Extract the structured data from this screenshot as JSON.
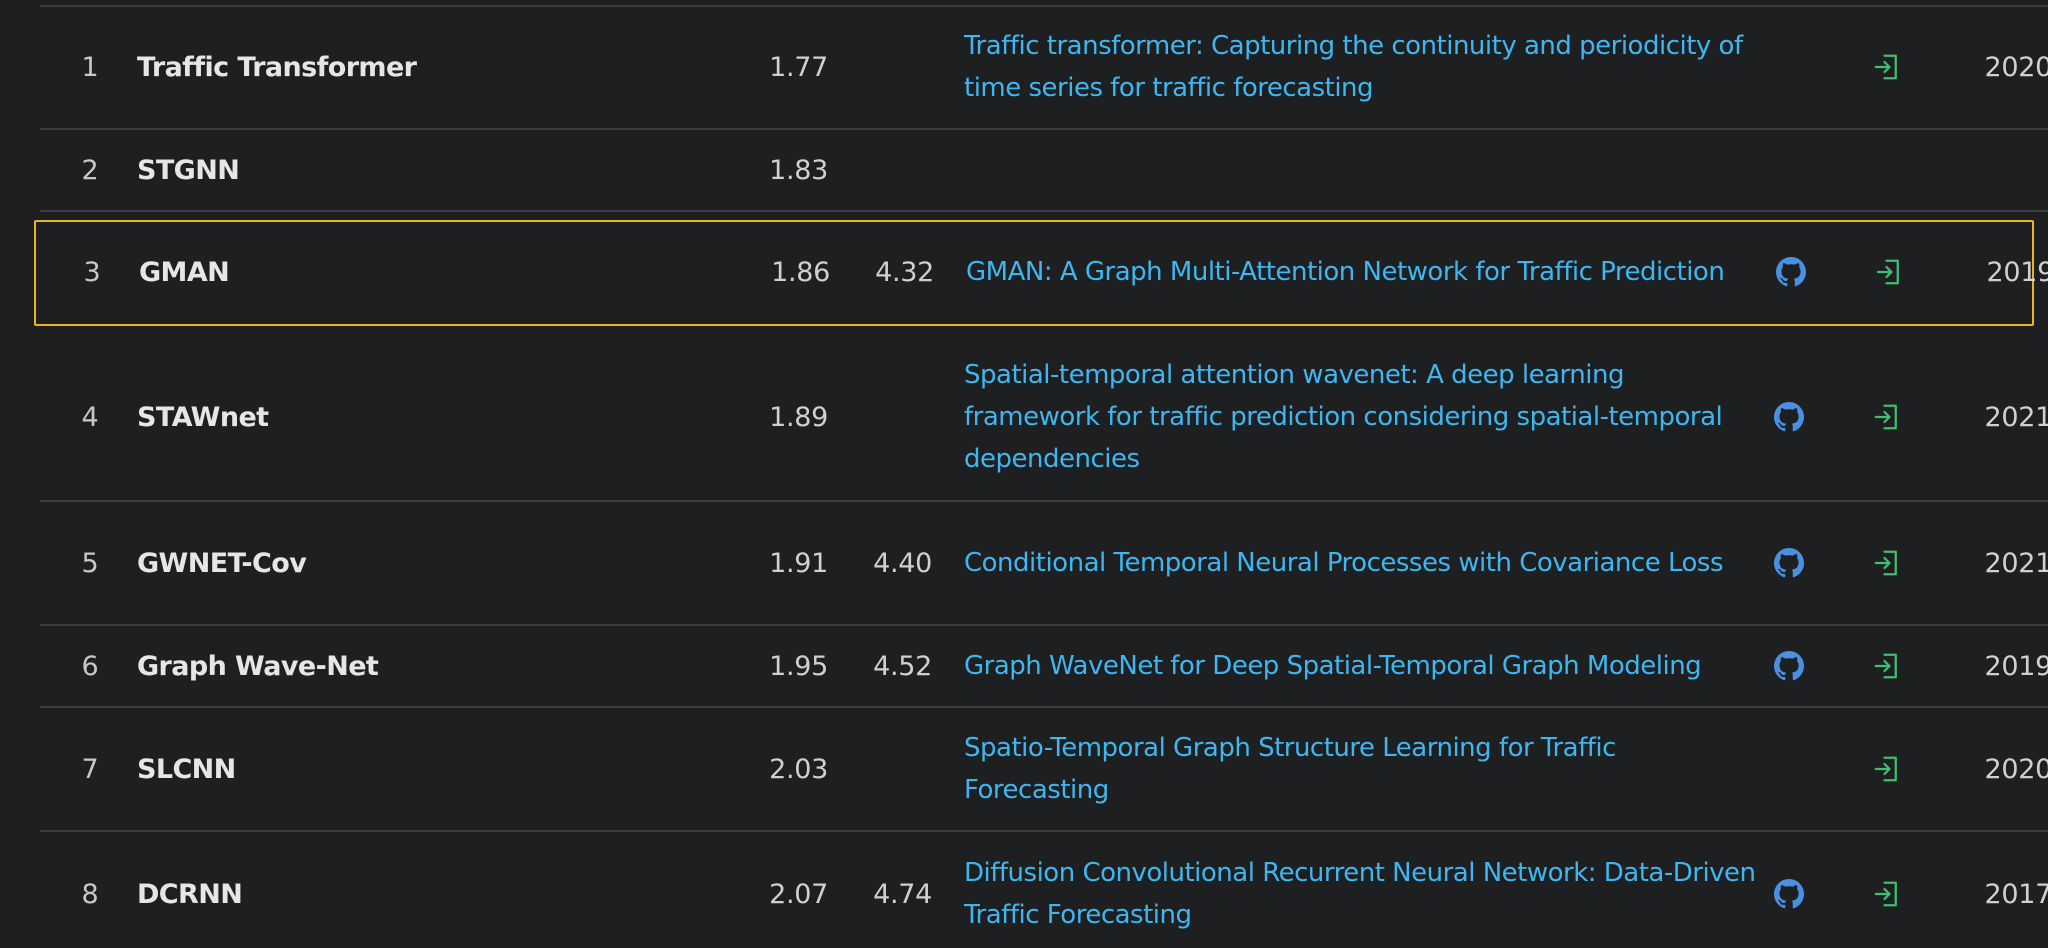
{
  "leaderboard": {
    "rows": [
      {
        "rank": "1",
        "model": "Traffic Transformer",
        "metric1": "1.77",
        "metric2": "",
        "paper": "Traffic transformer: Capturing the continuity and periodicity of time series for traffic forecasting",
        "has_code": false,
        "has_paper_link": true,
        "year": "2020"
      },
      {
        "rank": "2",
        "model": "STGNN",
        "metric1": "1.83",
        "metric2": "",
        "paper": "",
        "has_code": false,
        "has_paper_link": false,
        "year": ""
      },
      {
        "rank": "3",
        "model": "GMAN",
        "metric1": "1.86",
        "metric2": "4.32",
        "paper": "GMAN: A Graph Multi-Attention Network for Traffic Prediction",
        "has_code": true,
        "has_paper_link": true,
        "year": "2019"
      },
      {
        "rank": "4",
        "model": "STAWnet",
        "metric1": "1.89",
        "metric2": "",
        "paper": "Spatial-temporal attention wavenet: A deep learning framework for traffic prediction considering spatial-temporal dependencies",
        "has_code": true,
        "has_paper_link": true,
        "year": "2021"
      },
      {
        "rank": "5",
        "model": "GWNET-Cov",
        "metric1": "1.91",
        "metric2": "4.40",
        "paper": "Conditional Temporal Neural Processes with Covariance Loss",
        "has_code": true,
        "has_paper_link": true,
        "year": "2021"
      },
      {
        "rank": "6",
        "model": "Graph Wave-Net",
        "metric1": "1.95",
        "metric2": "4.52",
        "paper": "Graph WaveNet for Deep Spatial-Temporal Graph Modeling",
        "has_code": true,
        "has_paper_link": true,
        "year": "2019"
      },
      {
        "rank": "7",
        "model": "SLCNN",
        "metric1": "2.03",
        "metric2": "",
        "paper": "Spatio-Temporal Graph Structure Learning for Traffic Forecasting",
        "has_code": false,
        "has_paper_link": true,
        "year": "2020"
      },
      {
        "rank": "8",
        "model": "DCRNN",
        "metric1": "2.07",
        "metric2": "4.74",
        "paper": "Diffusion Convolutional Recurrent Neural Network: Data-Driven Traffic Forecasting",
        "has_code": true,
        "has_paper_link": true,
        "year": "2017"
      }
    ],
    "selected_rank": "3"
  },
  "colors": {
    "background": "#1e1f21",
    "link": "#3fb6f0",
    "code_icon": "#4a90e2",
    "paper_link_icon": "#3fbf6f",
    "selection_border": "#e8b526",
    "divider": "#3a3c40"
  },
  "icons": {
    "code": "github-icon",
    "paper_link": "enter-arrow-icon"
  }
}
